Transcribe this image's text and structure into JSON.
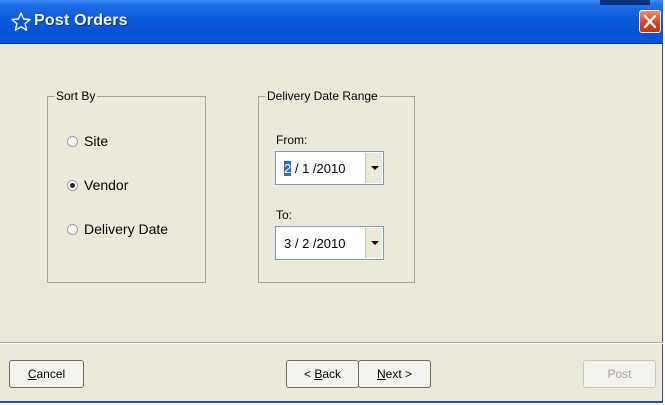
{
  "window": {
    "title": "Post Orders",
    "title_icon": "star-outline-icon",
    "close_icon": "close-icon"
  },
  "sort_by": {
    "label": "Sort By",
    "options": [
      {
        "label": "Site",
        "checked": false
      },
      {
        "label": "Vendor",
        "checked": true
      },
      {
        "label": "Delivery Date",
        "checked": false
      }
    ]
  },
  "delivery_date_range": {
    "label": "Delivery Date Range",
    "from": {
      "label": "From:",
      "month": "2",
      "rest": " / 1 /2010"
    },
    "to": {
      "label": "To:",
      "value": "3 / 2 /2010"
    }
  },
  "buttons": {
    "cancel": {
      "first": "C",
      "rest": "ancel"
    },
    "back": {
      "prefix": "< ",
      "first": "B",
      "rest": "ack"
    },
    "next": {
      "first": "N",
      "rest": "ext >"
    },
    "post": {
      "label": "Post",
      "enabled": false
    }
  },
  "colors": {
    "titlebar": "#0653d6",
    "face": "#ECE9D8",
    "selection": "#316ac5",
    "close": "#d8431e"
  }
}
